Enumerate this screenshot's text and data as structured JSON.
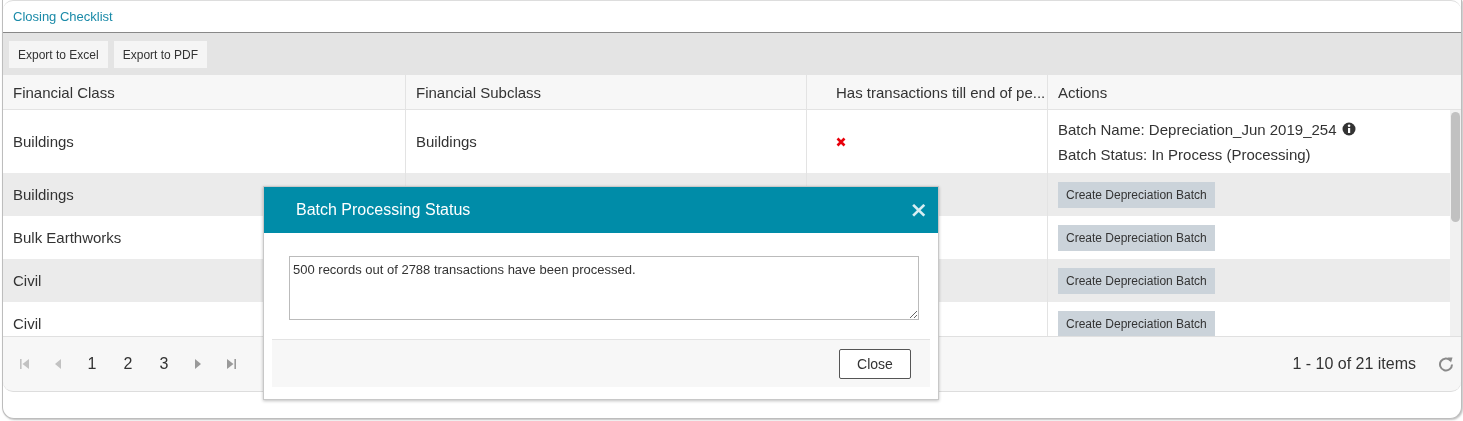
{
  "panel": {
    "title": "Closing Checklist"
  },
  "toolbar": {
    "buttons": [
      "Export to Excel",
      "Export to PDF"
    ]
  },
  "table": {
    "columns": [
      "Financial Class",
      "Financial Subclass",
      "Has transactions till end of pe...",
      "Actions"
    ],
    "rows": [
      {
        "financial_class": "Buildings",
        "financial_subclass": "Buildings",
        "has_transactions": false,
        "action": {
          "kind": "batch_info",
          "batch_name": "Batch Name: Depreciation_Jun 2019_254",
          "batch_status": "Batch Status: In Process (Processing)"
        }
      },
      {
        "financial_class": "Buildings",
        "action": {
          "kind": "button",
          "label": "Create Depreciation Batch"
        }
      },
      {
        "financial_class": "Bulk Earthworks",
        "action": {
          "kind": "button",
          "label": "Create Depreciation Batch"
        }
      },
      {
        "financial_class": "Civil",
        "action": {
          "kind": "button",
          "label": "Create Depreciation Batch"
        }
      },
      {
        "financial_class": "Civil",
        "action": {
          "kind": "button",
          "label": "Create Depreciation Batch"
        }
      }
    ]
  },
  "pager": {
    "pages": [
      "1",
      "2",
      "3"
    ],
    "summary": "1 - 10 of 21 items"
  },
  "dialog": {
    "title": "Batch Processing Status",
    "close_glyph": "×",
    "message": "500 records out of 2788 transactions have been processed.",
    "buttons": [
      "Close"
    ]
  }
}
